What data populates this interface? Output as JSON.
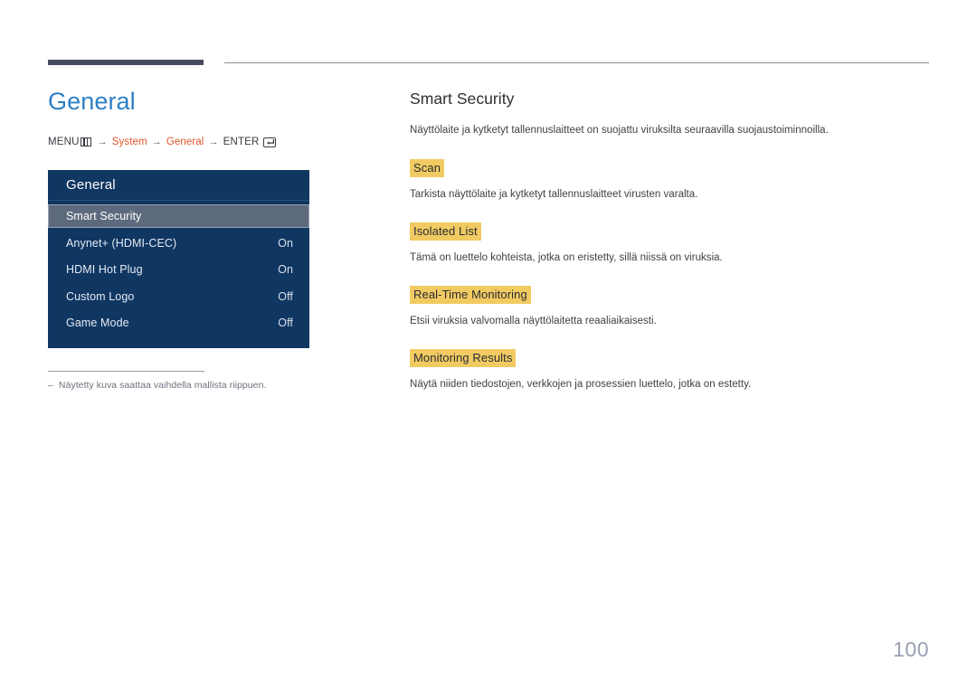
{
  "page": {
    "number": "100"
  },
  "left": {
    "title": "General",
    "breadcrumb": {
      "menu_label": "MENU",
      "menu_icon": "menu-grid-icon",
      "arrow": "→",
      "item1": "System",
      "item2": "General",
      "enter_label": "ENTER",
      "enter_icon": "enter-return-icon"
    },
    "osd": {
      "header": "General",
      "rows": [
        {
          "label": "Smart Security",
          "value": "",
          "selected": true
        },
        {
          "label": "Anynet+ (HDMI-CEC)",
          "value": "On",
          "selected": false
        },
        {
          "label": "HDMI Hot Plug",
          "value": "On",
          "selected": false
        },
        {
          "label": "Custom Logo",
          "value": "Off",
          "selected": false
        },
        {
          "label": "Game Mode",
          "value": "Off",
          "selected": false
        }
      ]
    },
    "footnote": {
      "dash": "–",
      "text": "Näytetty kuva saattaa vaihdella mallista riippuen."
    }
  },
  "right": {
    "title": "Smart Security",
    "intro": "Näyttölaite ja kytketyt tallennuslaitteet on suojattu viruksilta seuraavilla suojaustoiminnoilla.",
    "sections": [
      {
        "heading": "Scan",
        "text": "Tarkista näyttölaite ja kytketyt tallennuslaitteet virusten varalta."
      },
      {
        "heading": "Isolated List",
        "text": "Tämä on luettelo kohteista, jotka on eristetty, sillä niissä on viruksia."
      },
      {
        "heading": "Real-Time Monitoring",
        "text": "Etsii viruksia valvomalla näyttölaitetta reaaliaikaisesti."
      },
      {
        "heading": "Monitoring Results",
        "text": "Näytä niiden tiedostojen, verkkojen ja prosessien luettelo, jotka on estetty."
      }
    ]
  },
  "colors": {
    "accent_blue": "#2f7fc6",
    "breadcrumb_orange": "#e0542a",
    "osd_navy": "#103662",
    "osd_selected": "#5d6a7d",
    "highlight_yellow": "#f1cb62",
    "rule_dark": "#484c63",
    "page_number": "#9aa0b4"
  }
}
